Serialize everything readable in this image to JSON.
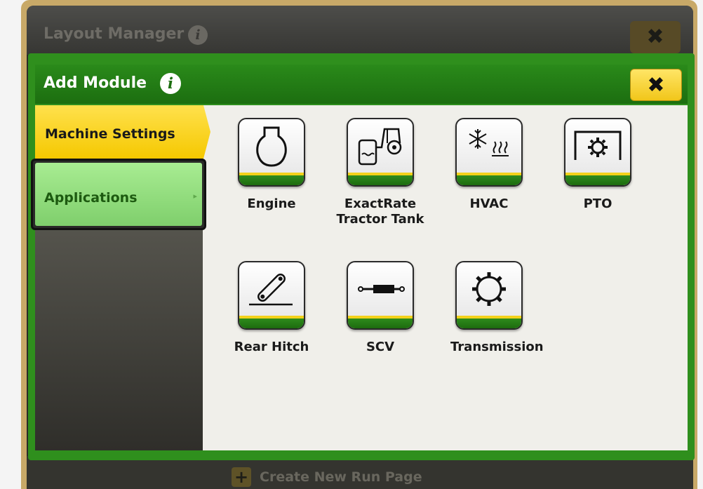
{
  "layout_manager": {
    "title": "Layout Manager",
    "info_glyph": "i",
    "close_glyph": "✖",
    "create_run_page_label": "Create New Run Page",
    "plus_glyph": "+"
  },
  "modal": {
    "title": "Add Module",
    "info_glyph": "i",
    "close_glyph": "✖"
  },
  "sidebar": {
    "tabs": [
      {
        "label": "Machine Settings",
        "state": "selected"
      },
      {
        "label": "Applications",
        "state": "focused",
        "arrow": "▸"
      }
    ]
  },
  "modules": [
    {
      "label": "Engine",
      "icon": "engine-icon"
    },
    {
      "label": "ExactRate Tractor Tank",
      "icon": "tractor-tank-icon"
    },
    {
      "label": "HVAC",
      "icon": "hvac-icon"
    },
    {
      "label": "PTO",
      "icon": "pto-icon"
    },
    {
      "label": "Rear Hitch",
      "icon": "rear-hitch-icon"
    },
    {
      "label": "SCV",
      "icon": "scv-icon"
    },
    {
      "label": "Transmission",
      "icon": "transmission-icon"
    }
  ],
  "colors": {
    "jd_green": "#1c6e10",
    "jd_yellow": "#f3d11a",
    "selected_tab": "#ffd21a",
    "focused_tab": "#8fdc7a"
  }
}
